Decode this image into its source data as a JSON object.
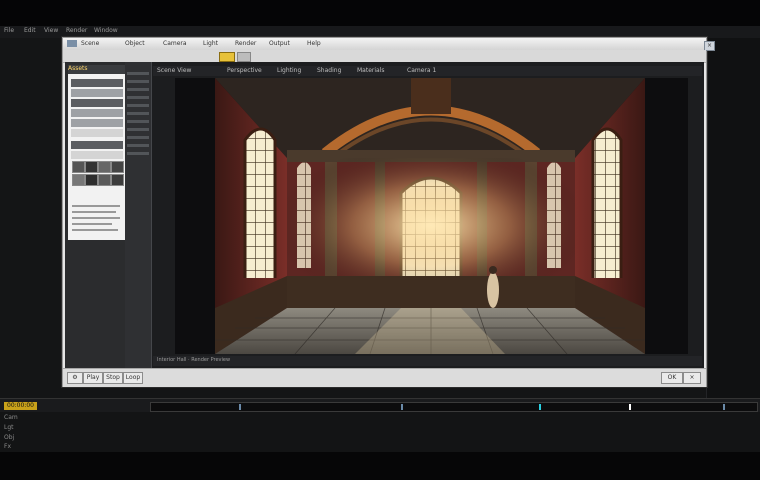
{
  "app": {
    "menu": [
      "File",
      "Edit",
      "View",
      "Render",
      "Window"
    ]
  },
  "window": {
    "title_items": [
      "Scene",
      "Object",
      "Camera",
      "Light",
      "Render",
      "Output",
      "Help"
    ],
    "controls": [
      "–",
      "□",
      "×"
    ]
  },
  "sidebar": {
    "header": "Assets",
    "rows": [
      "",
      "",
      "",
      "",
      "",
      "",
      "",
      ""
    ]
  },
  "viewport": {
    "tabs": [
      "Scene View",
      "Perspective",
      "Lighting",
      "Shading",
      "Materials",
      "Camera 1"
    ],
    "status": "Interior Hall · Render Preview"
  },
  "bottom_buttons": [
    "Play",
    "Stop",
    "Loop",
    "OK"
  ],
  "timeline": {
    "label": "00:00:00"
  },
  "tracks": [
    "Cam",
    "Lgt",
    "Obj",
    "Fx"
  ],
  "colors": {
    "accent": "#c9a21a",
    "wall": "#7a2e28",
    "wood": "#6b4628",
    "light": "#ffe9b5"
  }
}
